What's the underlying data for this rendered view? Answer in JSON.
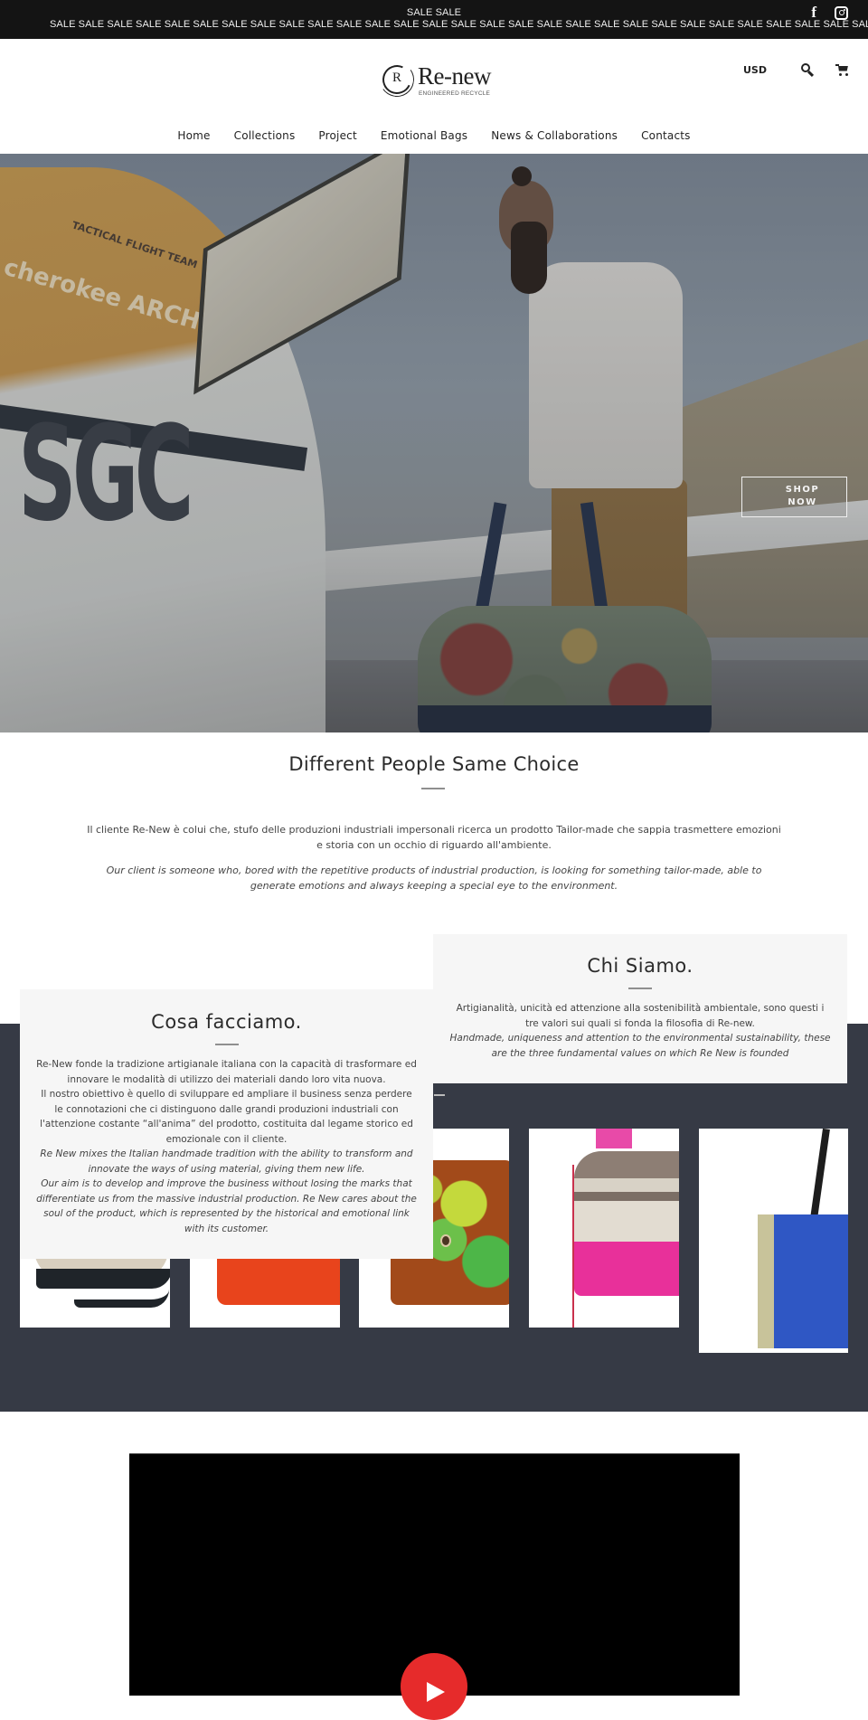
{
  "announcement": {
    "line1": "SALE SALE",
    "line2": "SALE SALE SALE SALE SALE SALE SALE SALE SALE SALE SALE SALE SALE SALE SALE SALE SALE SALE SALE SALE SALE SALE SALE SALE SALE SALE SALE SALE SALE",
    "social": [
      {
        "name": "facebook-icon",
        "glyph": "f"
      },
      {
        "name": "instagram-icon",
        "glyph": ""
      }
    ]
  },
  "header": {
    "logo": {
      "mark_letter": "R",
      "wordmark": "Re-new",
      "tagline": "ENGINEERED RECYCLE"
    },
    "currency": "USD",
    "icons": {
      "search": "search-icon",
      "cart": "cart-icon"
    }
  },
  "nav": {
    "items": [
      {
        "label": "Home"
      },
      {
        "label": "Collections"
      },
      {
        "label": "Project"
      },
      {
        "label": "Emotional Bags"
      },
      {
        "label": "News & Collaborations"
      },
      {
        "label": "Contacts"
      }
    ]
  },
  "hero": {
    "plane_text": "cherokee ARCHER",
    "plane_team": "TACTICAL FLIGHT TEAM",
    "plane_reg": "SGC",
    "cta_line1": "SHOP",
    "cta_line2": "NOW"
  },
  "intro": {
    "title": "Different People Same Choice",
    "text_it": "Il cliente Re-New è colui che, stufo delle produzioni industriali impersonali ricerca un prodotto Tailor-made che sappia trasmettere emozioni e storia con un occhio di riguardo all'ambiente.",
    "text_en": "Our client is someone who, bored with the repetitive products of industrial production, is looking for something tailor-made, able to generate emotions and always keeping a special eye to the environment."
  },
  "chi_siamo": {
    "title": "Chi Siamo.",
    "text_it": "Artigianalità, unicità ed attenzione alla sostenibilità ambientale, sono questi i tre valori sui quali si fonda la filosofia di Re-new.",
    "text_en": "Handmade, uniqueness and attention to the environmental sustainability, these are the three fundamental values on which Re New is founded"
  },
  "cosa_facciamo": {
    "title": "Cosa facciamo.",
    "para1_it": "Re-New fonde la tradizione artigianale italiana con la capacità di trasformare ed innovare le modalità di utilizzo dei materiali dando loro vita nuova.",
    "para2_it": "Il nostro obiettivo è quello di sviluppare ed ampliare il business senza perdere le connotazioni che ci distinguono dalle grandi produzioni industriali con l'attenzione costante “all'anima” del prodotto, costituita dal legame storico ed emozionale con il cliente.",
    "para1_en": "Re New mixes the Italian handmade tradition with the ability to transform and innovate the ways of using material, giving them new life.",
    "para2_en": "Our aim is to develop and improve the business without losing the marks that differentiate us from the massive industrial production. Re New cares about the soul of the product, which is represented by the historical and emotional link with its customer."
  },
  "products": [
    {
      "name": "black-beige-bag"
    },
    {
      "name": "orange-pouch"
    },
    {
      "name": "camo-green-bag"
    },
    {
      "name": "pink-striped-backpack"
    },
    {
      "name": "blue-tote-bag"
    }
  ],
  "video": {
    "play_icon": "play-icon"
  },
  "colors": {
    "announcement_bg": "#141414",
    "dark_band": "#363a45",
    "card_bg": "#f6f6f6",
    "play_red": "#e62b2b"
  }
}
